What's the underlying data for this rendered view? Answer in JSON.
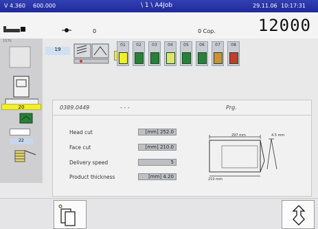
{
  "titlebar": {
    "version": "V 4.360",
    "code": "600.000",
    "title": "\\ 1 \\ A4Job",
    "date": "29.11.06",
    "time": "10:17:31"
  },
  "counter": {
    "left_value": "0",
    "copies": "0 Cop.",
    "big": "12000"
  },
  "left": {
    "v1": "20",
    "v2": "22",
    "v3": "1570"
  },
  "station": {
    "number": "19",
    "slots": [
      "01",
      "02",
      "03",
      "04",
      "05",
      "06",
      "07",
      "08"
    ]
  },
  "panel": {
    "job_id": "0389.0449",
    "dashes": "- - -",
    "prg": "Prg.",
    "fields": [
      {
        "label": "Head cut",
        "unit": "[mm]",
        "value": "252.0"
      },
      {
        "label": "Face cut",
        "unit": "[mm]",
        "value": "210.0"
      },
      {
        "label": "Delivery speed",
        "unit": "",
        "value": "5"
      },
      {
        "label": "Product thickness",
        "unit": "[mm]",
        "value": "4.20"
      }
    ],
    "diagram": {
      "top": "297 mm",
      "right": "4.5 mm",
      "bottom": "210 mm"
    }
  },
  "colors": {
    "titlebar": "#2633a6",
    "stage_yellow": "#f2ef2a",
    "icon_green": "#2a7f3a"
  }
}
